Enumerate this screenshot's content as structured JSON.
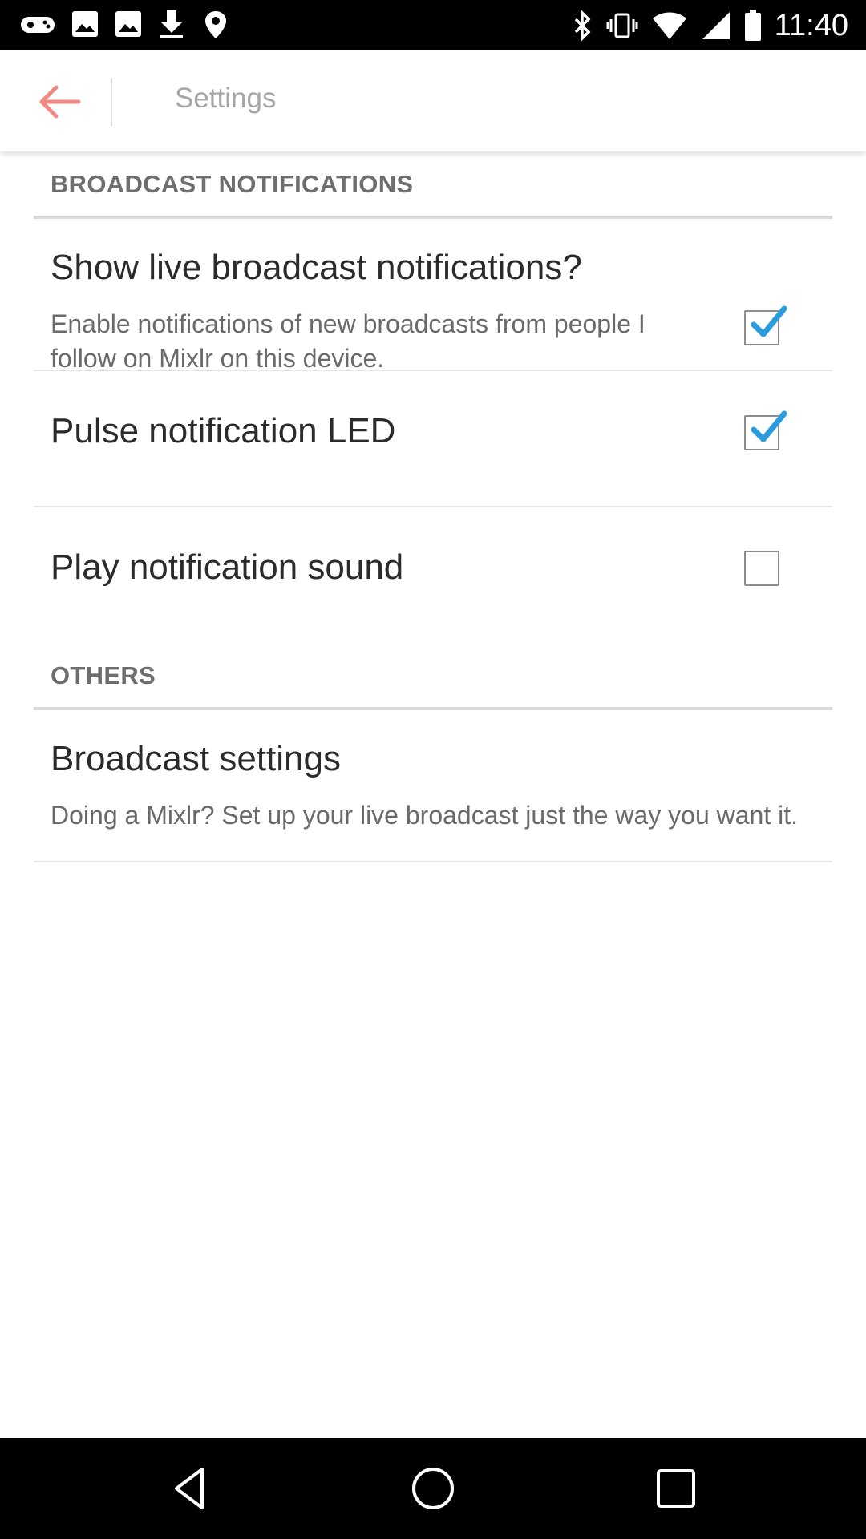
{
  "status_bar": {
    "time": "11:40",
    "left_icons": [
      "gamepad-icon",
      "image-icon",
      "image-icon",
      "download-icon",
      "fake-gps-icon"
    ],
    "right_icons": [
      "bluetooth-icon",
      "vibrate-icon",
      "wifi-icon",
      "cellular-icon",
      "battery-icon"
    ]
  },
  "app_bar": {
    "title": "Settings",
    "back_icon": "arrow-left-icon",
    "accent_color": "#f08a84"
  },
  "sections": {
    "broadcast": {
      "header": "BROADCAST NOTIFICATIONS",
      "items": [
        {
          "title": "Show live broadcast notifications?",
          "summary": "Enable notifications of new broadcasts from people I follow on Mixlr on this device.",
          "checked": true
        },
        {
          "title": "Pulse notification LED",
          "checked": true
        },
        {
          "title": "Play notification sound",
          "checked": false
        }
      ]
    },
    "others": {
      "header": "OTHERS",
      "items": [
        {
          "title": "Broadcast settings",
          "summary": "Doing a Mixlr? Set up your live broadcast just the way you want it."
        }
      ]
    }
  },
  "colors": {
    "check_color": "#2b9be0",
    "status_bar_bg": "#000000",
    "nav_bar_bg": "#000000"
  },
  "nav_bar": {
    "buttons": [
      "back-triangle-icon",
      "home-circle-icon",
      "recents-square-icon"
    ]
  }
}
